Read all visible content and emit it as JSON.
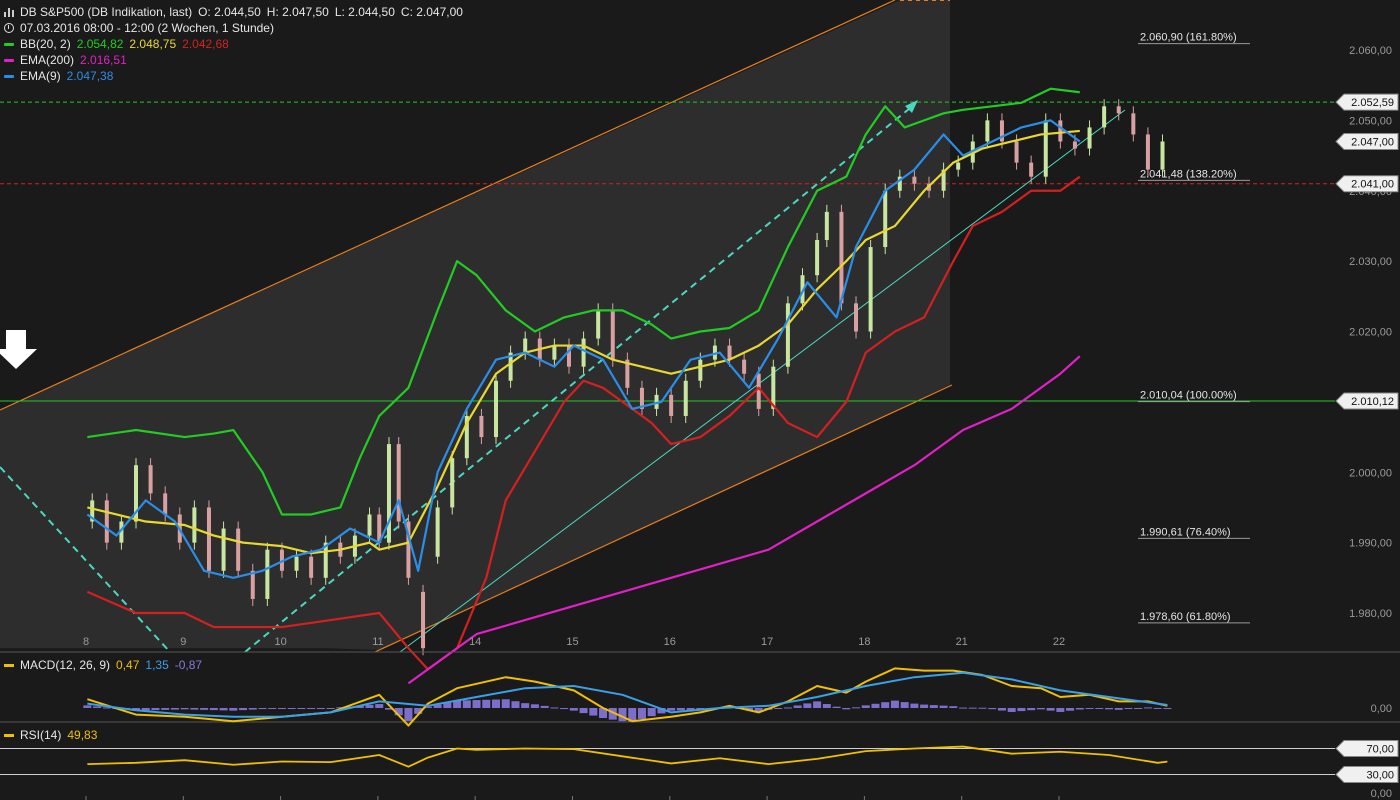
{
  "header": {
    "symbol_line": {
      "title": "DB S&P500 (DB Indikation, last)",
      "open": "O: 2.044,50",
      "high": "H: 2.047,50",
      "low": "L: 2.044,50",
      "close": "C: 2.047,00"
    },
    "time_line": "07.03.2016 08:00 - 12:00 (2 Wochen, 1 Stunde)",
    "bb": {
      "label": "BB(20, 2)",
      "upper": "2.054,82",
      "mid": "2.048,75",
      "lower": "2.042,68"
    },
    "ema200": {
      "label": "EMA(200)",
      "value": "2.016,51"
    },
    "ema9": {
      "label": "EMA(9)",
      "value": "2.047,38"
    }
  },
  "colors": {
    "background": "#1a1a1a",
    "bb_upper": "#22cc22",
    "bb_mid": "#e8d832",
    "bb_lower": "#d42020",
    "ema200": "#e020c8",
    "ema9": "#2a8ee8",
    "channel": "#e87e1e",
    "trend": "#4ad8c0",
    "candle_up": "#c8e6a0",
    "candle_down": "#d8a0a0",
    "macd": "#f0c000",
    "signal": "#3aa0e8",
    "histogram": "#8878e0",
    "rsi": "#f0c000"
  },
  "indicators": {
    "macd": {
      "label": "MACD(12, 26, 9)",
      "macd": "0,47",
      "signal": "1,35",
      "histogram": "-0,87"
    },
    "rsi": {
      "label": "RSI(14)",
      "value": "49,83"
    }
  },
  "chart_data": [
    {
      "type": "candlestick",
      "title": "DB S&P500 (DB Indikation, last)",
      "x_tick_labels": [
        "8",
        "9",
        "10",
        "11",
        "14",
        "15",
        "16",
        "17",
        "18",
        "21",
        "22"
      ],
      "y_tick_labels": [
        "1.980,00",
        "1.990,00",
        "2.000,00",
        "2.010,00",
        "2.020,00",
        "2.030,00",
        "2.040,00",
        "2.050,00",
        "2.060,00"
      ],
      "ylim": [
        1975,
        2063
      ],
      "grid": false,
      "price_flags": [
        {
          "label": "2.052,59",
          "value": 2052.59
        },
        {
          "label": "2.047,00",
          "value": 2047.0
        },
        {
          "label": "2.041,00",
          "value": 2041.0
        },
        {
          "label": "2.010,12",
          "value": 2010.12
        }
      ],
      "fib_levels": [
        {
          "label": "2.060,90 (161.80%)",
          "value": 2060.9
        },
        {
          "label": "2.041,48 (138.20%)",
          "value": 2041.48
        },
        {
          "label": "2.010,04 (100.00%)",
          "value": 2010.04
        },
        {
          "label": "1.990,61 (76.40%)",
          "value": 1990.61
        },
        {
          "label": "1.978,60 (61.80%)",
          "value": 1978.6
        }
      ],
      "horizontal_lines": [
        {
          "value": 2052.59,
          "style": "dashed",
          "color": "#22cc22"
        },
        {
          "value": 2041.0,
          "style": "dashed",
          "color": "#d42020"
        },
        {
          "value": 2010.12,
          "style": "solid",
          "color": "#22cc22"
        }
      ],
      "series": [
        {
          "name": "BB(20, 2)",
          "role": "upper",
          "x": [
            0,
            0.5,
            1,
            1.3,
            1.5,
            1.8,
            2,
            2.3,
            2.6,
            2.8,
            3,
            3.3,
            3.6,
            3.8,
            4,
            4.3,
            4.6,
            4.9,
            5.2,
            5.5,
            5.8,
            6,
            6.3,
            6.6,
            6.9,
            7.2,
            7.5,
            7.8,
            8,
            8.2,
            8.4,
            8.6,
            8.8,
            9,
            9.3,
            9.6,
            9.9,
            10.2
          ],
          "values": [
            2005,
            2006,
            2005,
            2005.5,
            2006,
            2000,
            1994,
            1994,
            1995,
            2002,
            2008,
            2012,
            2023,
            2030,
            2028,
            2023,
            2020,
            2022,
            2023,
            2023,
            2021,
            2019,
            2020,
            2020.5,
            2023,
            2032,
            2040,
            2042,
            2048,
            2052,
            2049,
            2050,
            2051,
            2051.5,
            2052,
            2052.5,
            2054.5,
            2054
          ],
          "color": "#22cc22"
        },
        {
          "name": "BB(20, 2)",
          "role": "middle",
          "x": [
            0,
            0.3,
            0.6,
            1,
            1.3,
            1.6,
            2,
            2.3,
            2.6,
            2.9,
            3,
            3.3,
            3.6,
            3.9,
            4.2,
            4.5,
            4.8,
            5.1,
            5.4,
            5.7,
            6,
            6.3,
            6.6,
            6.9,
            7.2,
            7.5,
            7.8,
            8,
            8.3,
            8.6,
            8.9,
            9.2,
            9.5,
            9.8,
            10.2
          ],
          "values": [
            1995,
            1994,
            1993,
            1992.5,
            1991,
            1990,
            1989.5,
            1988.5,
            1989,
            1990,
            1989,
            1990,
            1998,
            2007,
            2014,
            2017,
            2018,
            2018,
            2016,
            2015,
            2014,
            2015,
            2016,
            2018,
            2021,
            2026,
            2030,
            2033,
            2035,
            2040,
            2044,
            2046,
            2047,
            2048,
            2048.5
          ],
          "color": "#e8d832"
        },
        {
          "name": "BB(20, 2)",
          "role": "lower",
          "x": [
            0,
            0.5,
            1,
            1.3,
            1.6,
            2,
            2.5,
            3,
            3.3,
            3.5,
            3.8,
            4.1,
            4.3,
            4.6,
            4.9,
            5.1,
            5.3,
            5.5,
            5.8,
            6,
            6.3,
            6.6,
            6.9,
            7.2,
            7.5,
            7.8,
            8,
            8.3,
            8.6,
            8.9,
            9.1,
            9.4,
            9.7,
            10,
            10.2
          ],
          "values": [
            1983,
            1980,
            1980,
            1978,
            1978,
            1978,
            1979,
            1980,
            1975,
            1972,
            1975,
            1985,
            1996,
            2003,
            2010,
            2013,
            2012,
            2010,
            2007,
            2004,
            2005,
            2008,
            2012,
            2007,
            2005,
            2010,
            2017,
            2020,
            2022,
            2030,
            2035,
            2037,
            2040,
            2040,
            2042
          ],
          "color": "#d42020"
        },
        {
          "name": "EMA(200)",
          "x": [
            3.3,
            4,
            5,
            6,
            7,
            7.5,
            8,
            8.5,
            9,
            9.5,
            10,
            10.2
          ],
          "values": [
            1970,
            1977,
            1981,
            1985,
            1989,
            1993,
            1997,
            2001,
            2006,
            2009,
            2014,
            2016.5
          ],
          "color": "#e020c8"
        },
        {
          "name": "EMA(9)",
          "x": [
            0,
            0.3,
            0.6,
            0.9,
            1.2,
            1.5,
            1.8,
            2.1,
            2.4,
            2.7,
            3,
            3.2,
            3.4,
            3.6,
            3.9,
            4.2,
            4.5,
            4.8,
            5,
            5.3,
            5.6,
            5.9,
            6.2,
            6.5,
            6.8,
            7.1,
            7.4,
            7.7,
            7.9,
            8.2,
            8.5,
            8.8,
            9,
            9.3,
            9.6,
            9.9,
            10.2
          ],
          "values": [
            1994,
            1991,
            1996,
            1993,
            1986,
            1985,
            1986,
            1988,
            1989,
            1992,
            1990,
            1996,
            1986,
            2000,
            2009,
            2016,
            2017,
            2015,
            2018,
            2016,
            2009,
            2010,
            2016,
            2017,
            2012,
            2019,
            2027,
            2022,
            2032,
            2040,
            2043,
            2048,
            2045,
            2047,
            2049,
            2050,
            2047
          ],
          "color": "#2a8ee8"
        }
      ],
      "candles": [
        {
          "x": 0.05,
          "o": 1993,
          "c": 1996
        },
        {
          "x": 0.2,
          "o": 1996,
          "c": 1990
        },
        {
          "x": 0.35,
          "o": 1990,
          "c": 1993
        },
        {
          "x": 0.5,
          "o": 1993,
          "c": 2001
        },
        {
          "x": 0.65,
          "o": 2001,
          "c": 1997
        },
        {
          "x": 0.8,
          "o": 1997,
          "c": 1994
        },
        {
          "x": 0.95,
          "o": 1994,
          "c": 1990
        },
        {
          "x": 1.1,
          "o": 1990,
          "c": 1995
        },
        {
          "x": 1.25,
          "o": 1995,
          "c": 1986
        },
        {
          "x": 1.4,
          "o": 1986,
          "c": 1992
        },
        {
          "x": 1.55,
          "o": 1992,
          "c": 1986
        },
        {
          "x": 1.7,
          "o": 1986,
          "c": 1982
        },
        {
          "x": 1.85,
          "o": 1982,
          "c": 1989
        },
        {
          "x": 2.0,
          "o": 1989,
          "c": 1986
        },
        {
          "x": 2.15,
          "o": 1986,
          "c": 1988
        },
        {
          "x": 2.3,
          "o": 1988,
          "c": 1985
        },
        {
          "x": 2.45,
          "o": 1985,
          "c": 1990
        },
        {
          "x": 2.6,
          "o": 1990,
          "c": 1988
        },
        {
          "x": 2.75,
          "o": 1988,
          "c": 1991
        },
        {
          "x": 2.9,
          "o": 1991,
          "c": 1994
        },
        {
          "x": 3.0,
          "o": 1994,
          "c": 1990
        },
        {
          "x": 3.1,
          "o": 1990,
          "c": 2004
        },
        {
          "x": 3.2,
          "o": 2004,
          "c": 1993
        },
        {
          "x": 3.3,
          "o": 1993,
          "c": 1985
        },
        {
          "x": 3.45,
          "o": 1983,
          "c": 1975
        },
        {
          "x": 3.6,
          "o": 1988,
          "c": 1995
        },
        {
          "x": 3.75,
          "o": 1995,
          "c": 2002
        },
        {
          "x": 3.9,
          "o": 2002,
          "c": 2008
        },
        {
          "x": 4.05,
          "o": 2008,
          "c": 2005
        },
        {
          "x": 4.2,
          "o": 2005,
          "c": 2013
        },
        {
          "x": 4.35,
          "o": 2013,
          "c": 2017
        },
        {
          "x": 4.5,
          "o": 2017,
          "c": 2019
        },
        {
          "x": 4.65,
          "o": 2019,
          "c": 2016
        },
        {
          "x": 4.8,
          "o": 2016,
          "c": 2018
        },
        {
          "x": 4.95,
          "o": 2018,
          "c": 2015
        },
        {
          "x": 5.1,
          "o": 2015,
          "c": 2019
        },
        {
          "x": 5.25,
          "o": 2019,
          "c": 2023
        },
        {
          "x": 5.4,
          "o": 2023,
          "c": 2016
        },
        {
          "x": 5.55,
          "o": 2016,
          "c": 2012
        },
        {
          "x": 5.7,
          "o": 2012,
          "c": 2009
        },
        {
          "x": 5.85,
          "o": 2009,
          "c": 2011
        },
        {
          "x": 6.0,
          "o": 2011,
          "c": 2008
        },
        {
          "x": 6.15,
          "o": 2008,
          "c": 2013
        },
        {
          "x": 6.3,
          "o": 2013,
          "c": 2016
        },
        {
          "x": 6.45,
          "o": 2016,
          "c": 2018
        },
        {
          "x": 6.6,
          "o": 2018,
          "c": 2016
        },
        {
          "x": 6.75,
          "o": 2016,
          "c": 2014
        },
        {
          "x": 6.9,
          "o": 2014,
          "c": 2009
        },
        {
          "x": 7.05,
          "o": 2009,
          "c": 2015
        },
        {
          "x": 7.2,
          "o": 2015,
          "c": 2024
        },
        {
          "x": 7.35,
          "o": 2024,
          "c": 2028
        },
        {
          "x": 7.5,
          "o": 2028,
          "c": 2033
        },
        {
          "x": 7.6,
          "o": 2033,
          "c": 2037
        },
        {
          "x": 7.75,
          "o": 2037,
          "c": 2024
        },
        {
          "x": 7.9,
          "o": 2024,
          "c": 2020
        },
        {
          "x": 8.05,
          "o": 2020,
          "c": 2032
        },
        {
          "x": 8.2,
          "o": 2032,
          "c": 2040
        },
        {
          "x": 8.35,
          "o": 2040,
          "c": 2042
        },
        {
          "x": 8.5,
          "o": 2042,
          "c": 2041
        },
        {
          "x": 8.65,
          "o": 2041,
          "c": 2040
        },
        {
          "x": 8.8,
          "o": 2040,
          "c": 2043
        },
        {
          "x": 8.95,
          "o": 2043,
          "c": 2044
        },
        {
          "x": 9.1,
          "o": 2044,
          "c": 2047
        },
        {
          "x": 9.25,
          "o": 2047,
          "c": 2050
        },
        {
          "x": 9.4,
          "o": 2050,
          "c": 2047
        },
        {
          "x": 9.55,
          "o": 2047,
          "c": 2044
        },
        {
          "x": 9.7,
          "o": 2044,
          "c": 2042
        },
        {
          "x": 9.85,
          "o": 2042,
          "c": 2050
        },
        {
          "x": 10.0,
          "o": 2050,
          "c": 2047
        },
        {
          "x": 10.15,
          "o": 2047,
          "c": 2046
        },
        {
          "x": 10.3,
          "o": 2046,
          "c": 2049
        },
        {
          "x": 10.45,
          "o": 2049,
          "c": 2052
        },
        {
          "x": 10.6,
          "o": 2052,
          "c": 2051
        },
        {
          "x": 10.75,
          "o": 2051,
          "c": 2048
        },
        {
          "x": 10.9,
          "o": 2048,
          "c": 2043
        },
        {
          "x": 11.05,
          "o": 2043,
          "c": 2047
        }
      ]
    },
    {
      "type": "line",
      "title": "MACD(12, 26, 9)",
      "y_tick_labels": [
        "0,00"
      ],
      "series": [
        {
          "name": "MACD",
          "x": [
            0,
            0.5,
            1,
            1.5,
            2,
            2.5,
            3,
            3.3,
            3.5,
            3.8,
            4,
            4.3,
            4.6,
            5,
            5.3,
            5.6,
            6,
            6.3,
            6.6,
            6.9,
            7.2,
            7.5,
            7.8,
            8,
            8.3,
            8.6,
            8.9,
            9.2,
            9.5,
            9.8,
            10,
            10.3,
            10.6,
            10.9,
            11.1
          ],
          "values": [
            4,
            -3,
            -4,
            -6,
            -4,
            -2,
            6,
            -8,
            2,
            9,
            11,
            14,
            12,
            8,
            0,
            -6,
            -4,
            -2,
            1,
            -2,
            3,
            10,
            7,
            12,
            18,
            17,
            17,
            15,
            10,
            9,
            5,
            6,
            3,
            3,
            1
          ],
          "color": "#f0c000"
        },
        {
          "name": "Signal",
          "x": [
            0,
            0.5,
            1,
            1.5,
            2,
            2.5,
            3,
            3.5,
            4,
            4.5,
            5,
            5.5,
            6,
            6.5,
            7,
            7.5,
            8,
            8.5,
            9,
            9.5,
            10,
            10.5,
            11.1
          ],
          "values": [
            2,
            -1,
            -3,
            -4,
            -4,
            -2,
            3,
            1,
            5,
            9,
            10,
            6,
            -2,
            0,
            1,
            5,
            10,
            14,
            16,
            13,
            8,
            5,
            1.35
          ],
          "color": "#3aa0e8"
        }
      ]
    },
    {
      "type": "line",
      "title": "RSI(14)",
      "y_tick_labels": [
        "70,00",
        "30,00",
        "0,00"
      ],
      "ylim": [
        0,
        100
      ],
      "series": [
        {
          "name": "RSI(14)",
          "x": [
            0,
            0.5,
            1,
            1.5,
            2,
            2.5,
            3,
            3.3,
            3.5,
            3.8,
            4,
            4.5,
            5,
            5.5,
            6,
            6.5,
            7,
            7.5,
            8,
            8.5,
            9,
            9.5,
            10,
            10.5,
            11,
            11.1
          ],
          "values": [
            46,
            48,
            52,
            45,
            50,
            49,
            60,
            42,
            56,
            70,
            68,
            70,
            69,
            58,
            47,
            55,
            46,
            54,
            66,
            70,
            73,
            62,
            65,
            60,
            48,
            49.83
          ],
          "color": "#f0c000"
        }
      ]
    }
  ]
}
